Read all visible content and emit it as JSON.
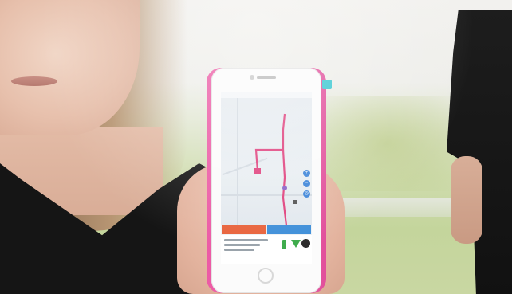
{
  "scene": {
    "subject": "",
    "colors": {
      "phone_case": "#ec5aa5",
      "route_line": "#e0427e",
      "route_marker": "#8b62c6",
      "left_button": "#e8633c",
      "right_button": "#3f8fd9",
      "status_green": "#3dab4b"
    }
  },
  "phone": {
    "app": {
      "left_button_label": "",
      "right_button_label": "",
      "icons": [
        "battery-icon",
        "signal-icon",
        "record-icon",
        "zoom-in-icon",
        "zoom-out-icon",
        "locate-icon"
      ]
    }
  }
}
